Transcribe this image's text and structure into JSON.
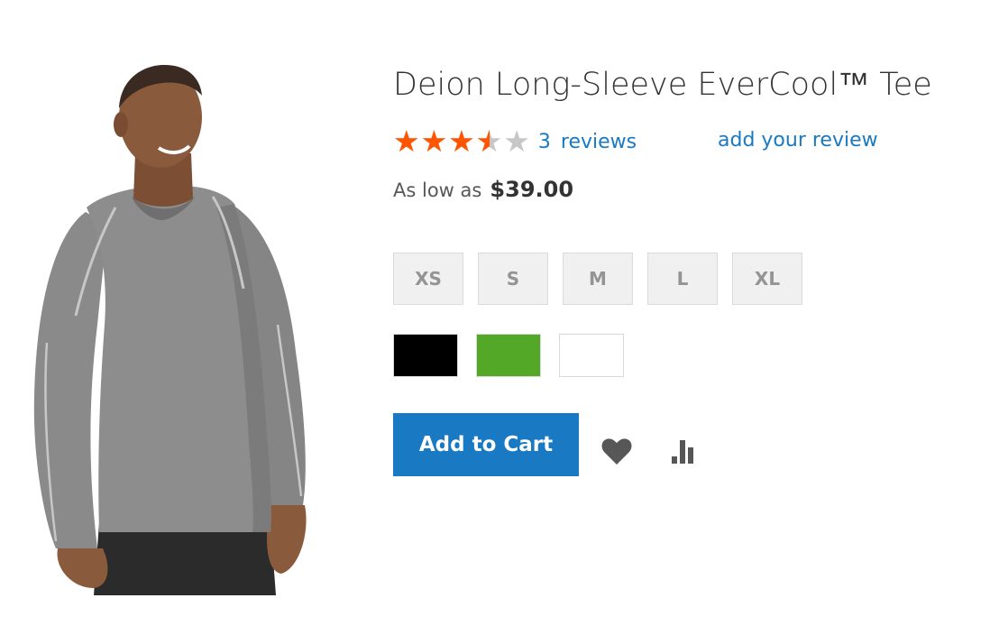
{
  "product": {
    "title": "Deion Long-Sleeve EverCool™ Tee",
    "image_alt": "Man wearing a gray long-sleeve tee",
    "rating": {
      "stars_shown": "★★★★★",
      "value": 3.5,
      "max": 5,
      "reviews_count": "3",
      "reviews_label": "reviews",
      "add_review_label": "add your review"
    },
    "price": {
      "label": "As low as",
      "amount": "$39.00"
    },
    "sizes": [
      "XS",
      "S",
      "M",
      "L",
      "XL"
    ],
    "colors": [
      {
        "name": "black",
        "hex": "#000000"
      },
      {
        "name": "green",
        "hex": "#53a828"
      },
      {
        "name": "white",
        "hex": "#ffffff"
      }
    ],
    "actions": {
      "add_to_cart_label": "Add to Cart",
      "wishlist_icon": "heart-icon",
      "compare_icon": "bar-chart-icon"
    }
  },
  "theme": {
    "accent": "#1979c3",
    "star_color": "#ff5501",
    "star_empty": "#c7c7c7",
    "swatch_bg": "#f0f0f0",
    "text": "#333333"
  }
}
